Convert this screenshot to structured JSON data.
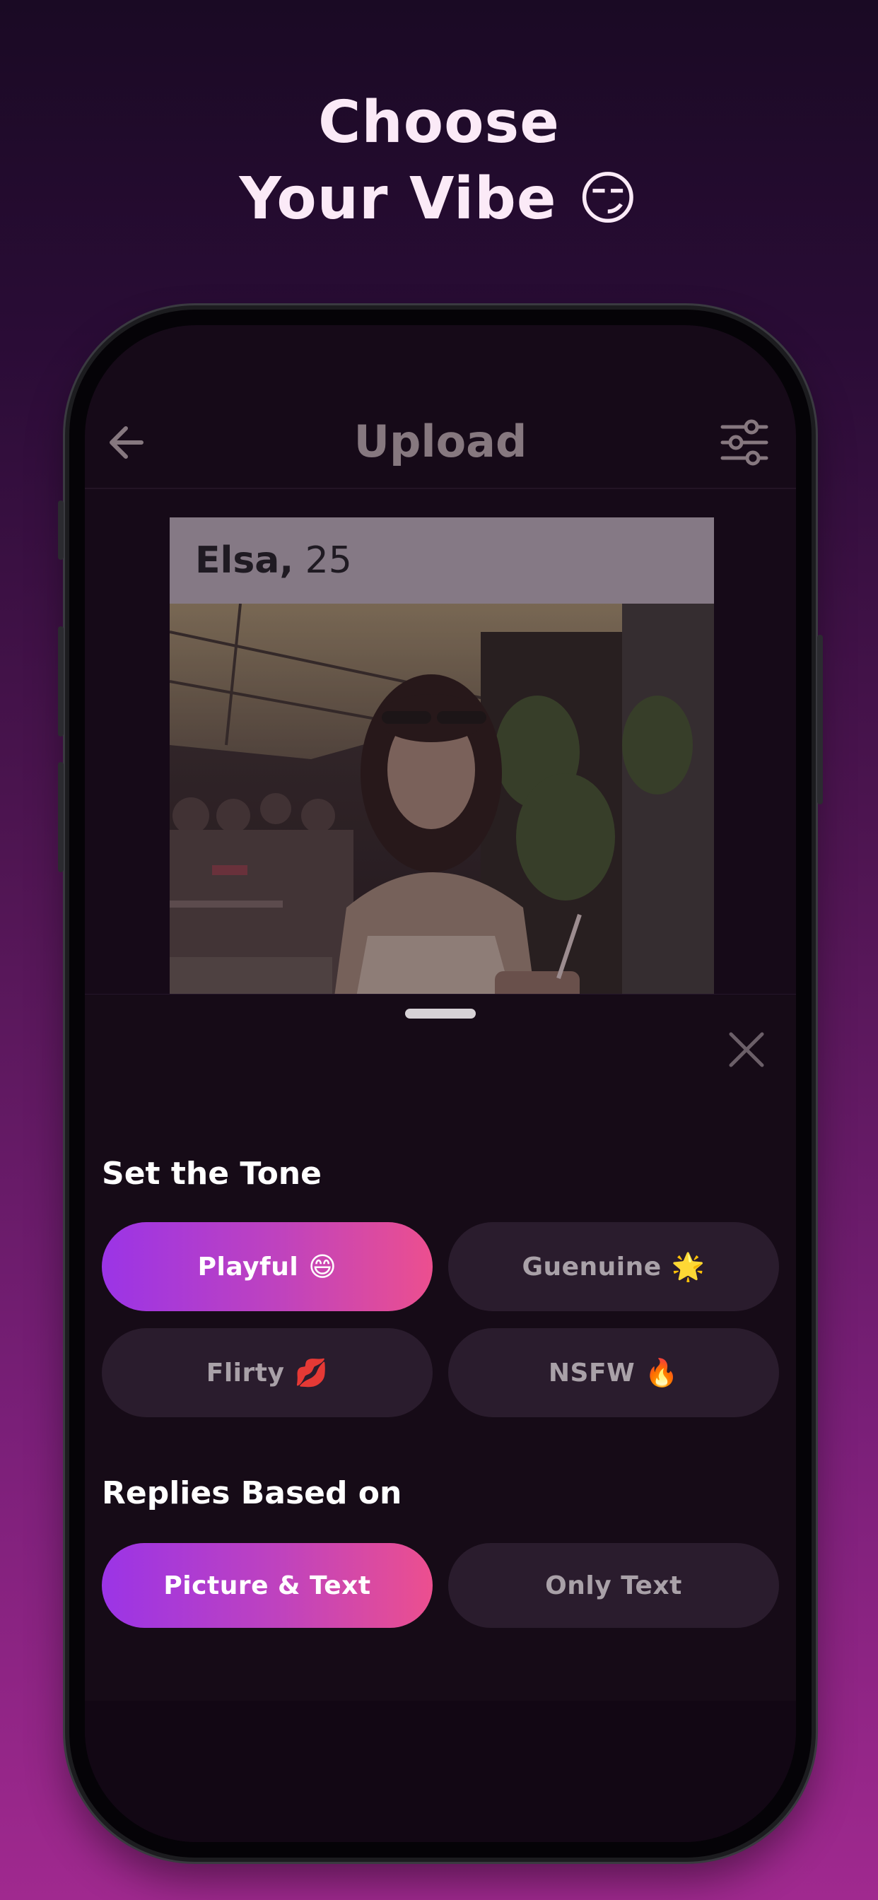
{
  "hero": {
    "line1": "Choose",
    "line2": "Your Vibe",
    "emoji": "😏"
  },
  "header": {
    "title": "Upload",
    "back_icon": "arrow-left-icon",
    "filter_icon": "sliders-icon"
  },
  "profile": {
    "name": "Elsa,",
    "age": "25"
  },
  "sheet": {
    "close_icon": "close-icon",
    "tone_label": "Set the Tone",
    "tones": [
      {
        "label": "Playful",
        "emoji": "😄",
        "selected": true
      },
      {
        "label": "Guenuine",
        "emoji": "🌟",
        "selected": false
      },
      {
        "label": "Flirty",
        "emoji": "💋",
        "selected": false
      },
      {
        "label": "NSFW",
        "emoji": "🔥",
        "selected": false
      }
    ],
    "replies_label": "Replies Based on",
    "replies": [
      {
        "label": "Picture & Text",
        "selected": true
      },
      {
        "label": "Only Text",
        "selected": false
      }
    ]
  },
  "colors": {
    "accent_start": "#9b34e6",
    "accent_end": "#ec4f8f",
    "background": "#160b17"
  }
}
